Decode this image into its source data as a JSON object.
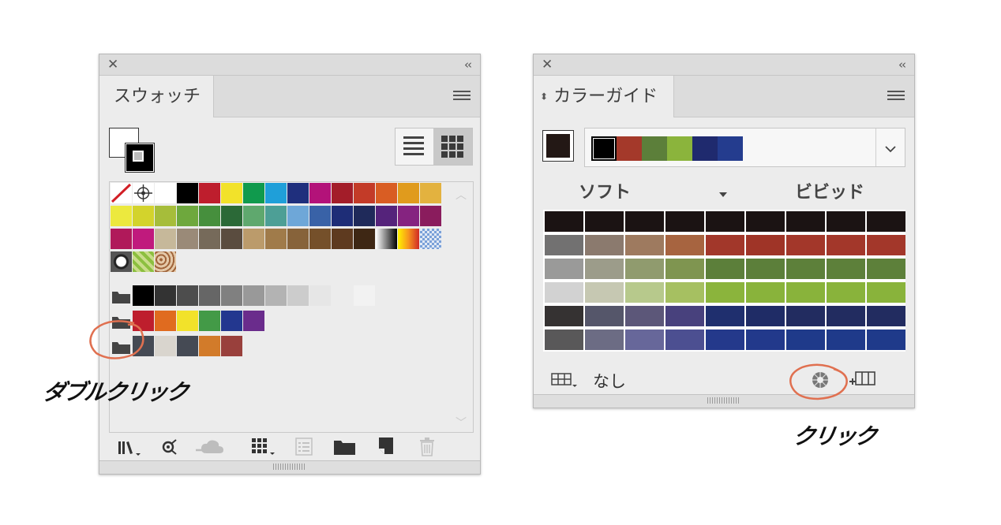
{
  "swatches_panel": {
    "tab_label": "スウォッチ",
    "rows": [
      [
        "none",
        "registration",
        "#ffffff",
        "#000000",
        "#be1e2d",
        "#f2e22a",
        "#109a4d",
        "#1f9fd9",
        "#1f2f7d",
        "#b31279",
        "#a31d29",
        "#c33b28",
        "#d95d23",
        "#e09b1d",
        "#e3b23f"
      ],
      [
        "#ece93e",
        "#d3d32c",
        "#a6bd3a",
        "#6ea83d",
        "#468f3d",
        "#2b6937",
        "#5fa86e",
        "#4d9f96",
        "#6ea7d8",
        "#3962a7",
        "#1e2d77",
        "#1f2a5a",
        "#55237b",
        "#852380",
        "#8a1c5d"
      ],
      [
        "#b0195a",
        "#c01a7d",
        "#c6b89a",
        "#9a8a78",
        "#766a5a",
        "#5a4c3f",
        "#bb9b6b",
        "#a07b4a",
        "#87633a",
        "#75502a",
        "#5e3a1f",
        "#3e2714",
        "grad-bw",
        "grad-yellow",
        "transparent-check"
      ],
      [
        "pattern-dot",
        "pattern-leaf",
        "pattern-paisley"
      ]
    ],
    "group1": [
      "#000000",
      "#333333",
      "#4d4d4d",
      "#666666",
      "#808080",
      "#999999",
      "#b3b3b3",
      "#cccccc",
      "#e6e6e6",
      "#ececec",
      "#f2f2f2"
    ],
    "group2": [
      "#be1e2d",
      "#e06b1f",
      "#f2e22a",
      "#439a47",
      "#23378f",
      "#6a2c8c"
    ],
    "group3": [
      "#454a54",
      "#d9d5ce",
      "#454a54",
      "#d27b2a",
      "#99403c"
    ],
    "annotation": "ダブルクリック"
  },
  "color_guide_panel": {
    "tab_label": "カラーガイド",
    "harmony": [
      "#000000",
      "#a4392a",
      "#5c7f3a",
      "#8bb43c",
      "#1f2a6e",
      "#243c8e"
    ],
    "soft_label": "ソフト",
    "vivid_label": "ビビッド",
    "grid": [
      [
        "#1b1313",
        "#1b1313",
        "#1b1313",
        "#1b1313",
        "#1b1313",
        "#1b1313",
        "#1b1313",
        "#1b1313",
        "#1b1313"
      ],
      [
        "#727171",
        "#8b7a6e",
        "#9e7a5f",
        "#a76440",
        "#a2372a",
        "#9f3427",
        "#a3372a",
        "#a3372a",
        "#a3372a"
      ],
      [
        "#9a9a99",
        "#9c9c8a",
        "#909b6e",
        "#7f9550",
        "#5c7f3a",
        "#5c7f3a",
        "#5d803a",
        "#5d803a",
        "#5d803a"
      ],
      [
        "#d2d2d2",
        "#c6c8b2",
        "#b7c98c",
        "#a6c061",
        "#8bb43c",
        "#89b33b",
        "#89b33b",
        "#89b33b",
        "#89b33b"
      ],
      [
        "#353232",
        "#55566a",
        "#5c5779",
        "#48417d",
        "#1f2f6e",
        "#1f2c66",
        "#222c60",
        "#222c60",
        "#222c60"
      ],
      [
        "#595859",
        "#6c6c84",
        "#67679a",
        "#4c4f91",
        "#24398b",
        "#22398b",
        "#1f3a8a",
        "#1f3a8a",
        "#1f3a8a"
      ]
    ],
    "bottom_label": "なし",
    "annotation": "クリック"
  }
}
